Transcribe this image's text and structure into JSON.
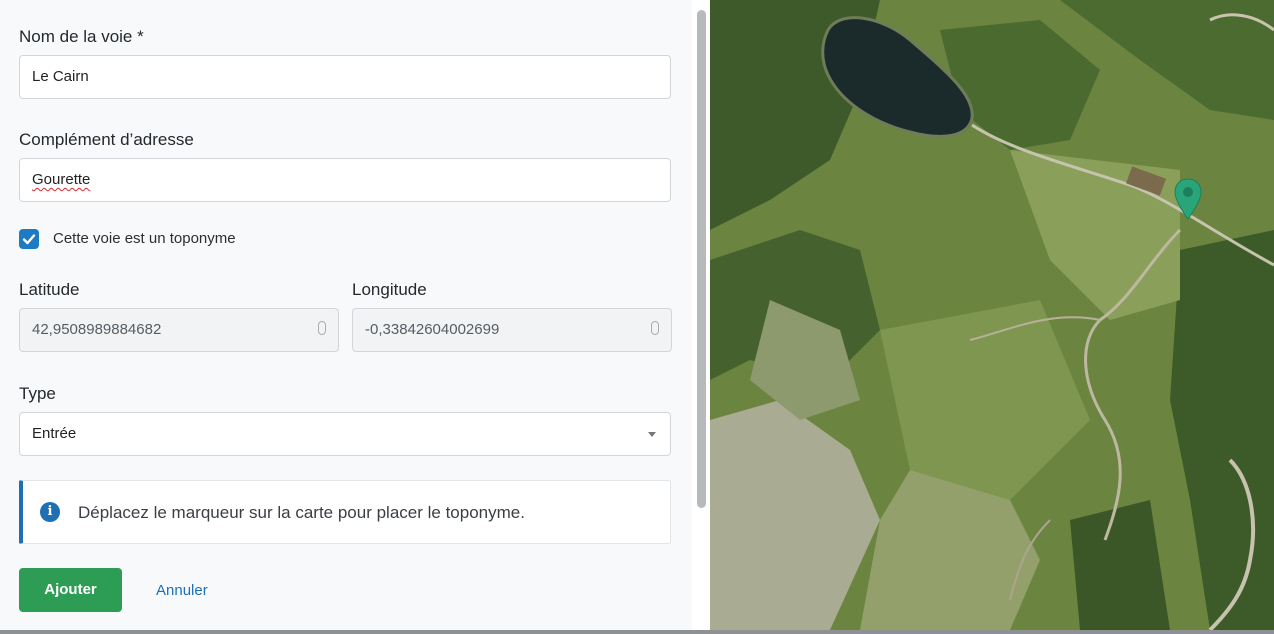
{
  "form": {
    "street_label": "Nom de la voie *",
    "street_value": "Le Cairn",
    "complement_label": "Complément d’adresse",
    "complement_value": "Gourette",
    "toponym_checkbox_label": "Cette voie est un toponyme",
    "toponym_checked": true,
    "latitude_label": "Latitude",
    "latitude_value": "42,9508989884682",
    "longitude_label": "Longitude",
    "longitude_value": "-0,33842604002699",
    "type_label": "Type",
    "type_value": "Entrée"
  },
  "info": {
    "message": "Déplacez le marqueur sur la carte pour placer le toponyme."
  },
  "actions": {
    "add_label": "Ajouter",
    "cancel_label": "Annuler"
  },
  "colors": {
    "accent": "#1f7ac4",
    "add_button": "#2d9c55",
    "map_marker": "#2aa57a"
  },
  "icons": {
    "checkbox": "check-icon",
    "info": "info-icon",
    "marker": "map-marker-icon",
    "select": "chevron-down-icon",
    "number": "spinner-icon"
  }
}
